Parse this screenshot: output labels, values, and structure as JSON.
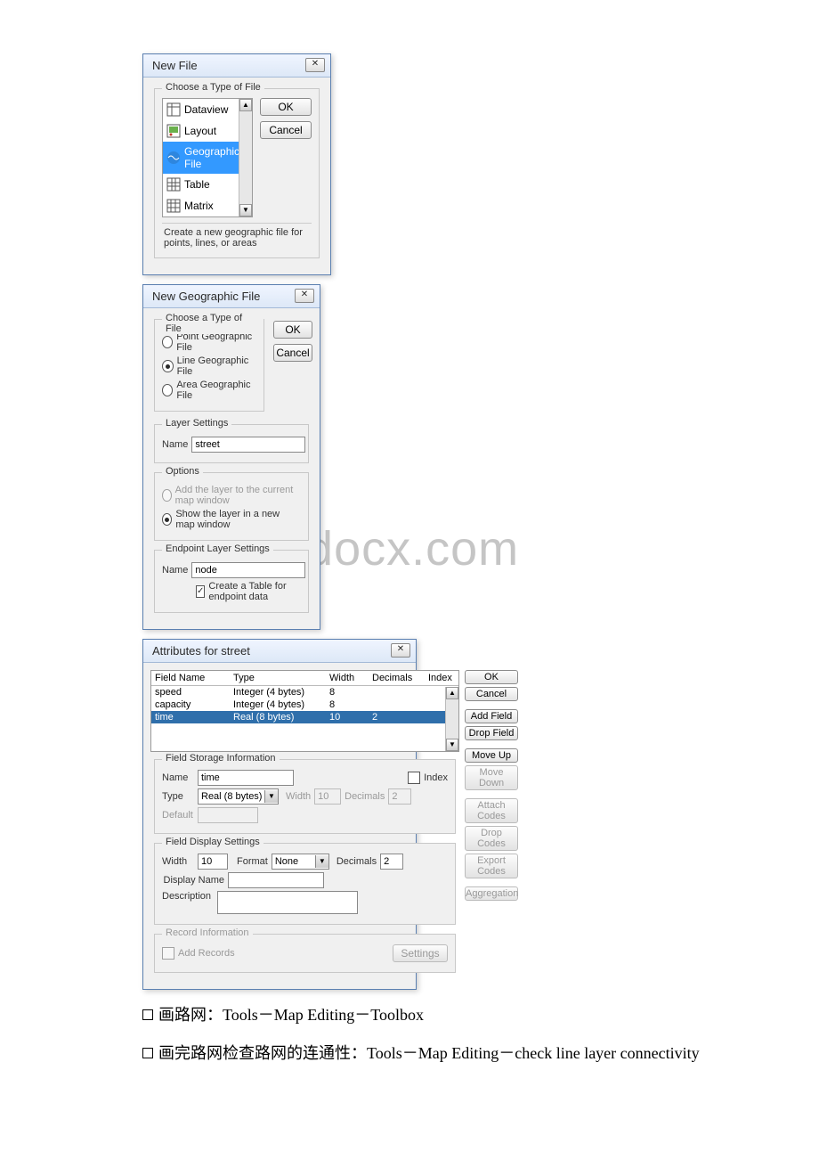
{
  "watermark": "www.bdocx.com",
  "dialog1": {
    "title": "New File",
    "close": "✕",
    "group_label": "Choose a Type of File",
    "items": [
      "Dataview",
      "Layout",
      "Geographic File",
      "Table",
      "Matrix"
    ],
    "scroll_up": "▲",
    "scroll_down": "▼",
    "ok": "OK",
    "cancel": "Cancel",
    "description": "Create a new geographic file for points, lines, or areas"
  },
  "dialog2": {
    "title": "New Geographic File",
    "close": "✕",
    "group1_label": "Choose a Type of File",
    "radio_point": "Point Geographic File",
    "radio_line": "Line Geographic File",
    "radio_area": "Area Geographic File",
    "ok": "OK",
    "cancel": "Cancel",
    "group2_label": "Layer Settings",
    "name_label": "Name",
    "name_value": "street",
    "group3_label": "Options",
    "opt1": "Add the layer to the current map window",
    "opt2": "Show the layer in a new map window",
    "group4_label": "Endpoint Layer Settings",
    "name2_label": "Name",
    "name2_value": "node",
    "check_label": "Create a Table for endpoint data"
  },
  "dialog3": {
    "title": "Attributes for street",
    "close": "✕",
    "headers": {
      "name": "Field Name",
      "type": "Type",
      "width": "Width",
      "dec": "Decimals",
      "idx": "Index"
    },
    "rows": [
      {
        "name": "speed",
        "type": "Integer (4 bytes)",
        "width": "8",
        "dec": "",
        "idx": ""
      },
      {
        "name": "capacity",
        "type": "Integer (4 bytes)",
        "width": "8",
        "dec": "",
        "idx": ""
      },
      {
        "name": "time",
        "type": "Real (8 bytes)",
        "width": "10",
        "dec": "2",
        "idx": ""
      }
    ],
    "scroll_up": "▲",
    "scroll_down": "▼",
    "btns": {
      "ok": "OK",
      "cancel": "Cancel",
      "add": "Add Field",
      "drop": "Drop Field",
      "up": "Move Up",
      "down": "Move Down",
      "attach": "Attach Codes",
      "dropc": "Drop Codes",
      "export": "Export Codes",
      "aggr": "Aggregation"
    },
    "storage": {
      "group": "Field Storage Information",
      "name_l": "Name",
      "name_v": "time",
      "type_l": "Type",
      "type_v": "Real (8 bytes)",
      "width_l": "Width",
      "width_v": "10",
      "dec_l": "Decimals",
      "dec_v": "2",
      "default_l": "Default",
      "default_v": "",
      "index_l": "Index"
    },
    "display": {
      "group": "Field Display Settings",
      "width_l": "Width",
      "width_v": "10",
      "format_l": "Format",
      "format_v": "None",
      "dec_l": "Decimals",
      "dec_v": "2",
      "disp_l": "Display Name",
      "disp_v": "",
      "desc_l": "Description",
      "desc_v": ""
    },
    "record": {
      "group": "Record Information",
      "add_l": "Add Records",
      "settings": "Settings"
    }
  },
  "footer": {
    "line1_cn": "画路网：",
    "line1_en": "Tools－Map Editing－Toolbox",
    "line2_cn": "画完路网检查路网的连通性：",
    "line2_en": "Tools－Map Editing－check line layer connectivity"
  }
}
